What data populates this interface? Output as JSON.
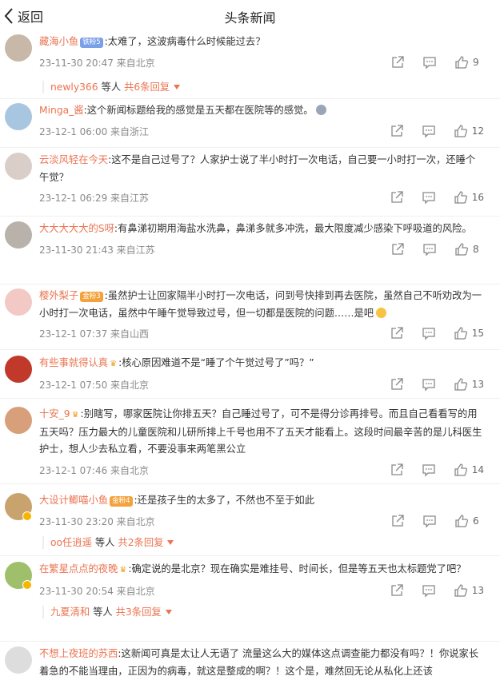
{
  "header": {
    "back_label": "返回",
    "title": "头条新闻"
  },
  "comments": [
    {
      "user": "藏海小鱼",
      "badge": "铁粉5",
      "badge_color": "#7aa0e8",
      "text": ":太难了，这波病毒什么时候能过去？",
      "time": "23-11-30 20:47 来自北京",
      "likes": "9",
      "reply_user": "newly366",
      "reply_mid": "等人",
      "reply_count": "共6条回复",
      "avatar_color": "#c8b8a8"
    },
    {
      "user": "Minga_酱",
      "text": ":这个新闻标题给我的感觉是五天都在医院等的感觉。",
      "time": "23-12-1 06:00 来自浙江",
      "likes": "12",
      "avatar_color": "#a9c6e0"
    },
    {
      "user": "云淡风轻在今天",
      "text": ":这不是自己过号了？人家护士说了半小时打一次电话，自己要一小时打一次，还睡个午觉？",
      "time": "23-12-1 06:29 来自江苏",
      "likes": "16",
      "avatar_color": "#d9cfc8"
    },
    {
      "user": "大大大大大的S呀",
      "text": ":有鼻涕初期用海盐水洗鼻，鼻涕多就多冲洗，最大限度减少感染下呼吸道的风险。",
      "time": "23-11-30 21:43 来自江苏",
      "likes": "8",
      "avatar_color": "#b9b2aa"
    },
    {
      "user": "樱外梨子",
      "badge": "金粉3",
      "badge_color": "#f3a23c",
      "text": ":虽然护士让回家隔半小时打一次电话，问到号快排到再去医院，虽然自己不听劝改为一小时打一次电话，虽然中午睡午觉导致过号，但一切都是医院的问题……是吧",
      "time": "23-12-1 07:37 来自山西",
      "likes": "15",
      "avatar_color": "#f2c9c4"
    },
    {
      "user": "有些事就得认真",
      "crown": "♛",
      "text": ":核心原因难道不是“睡了个午觉过号了”吗？”",
      "time": "23-12-1 07:50 来自北京",
      "likes": "13",
      "avatar_color": "#c0392b"
    },
    {
      "user": "十安_9",
      "crown": "♛",
      "text": ":别瞎写，哪家医院让你排五天？自己睡过号了，可不是得分诊再排号。而且自己看看写的用五天吗？压力最大的儿童医院和儿研所排上千号也用不了五天才能看上。这段时间最辛苦的是儿科医生护士，想人少去私立看，不要没事来两笔黑公立",
      "time": "23-12-1 07:46 来自北京",
      "likes": "14",
      "avatar_color": "#d8a07a"
    },
    {
      "user": "大设计鲫喵小鱼",
      "badge": "金粉4",
      "badge_color": "#f3a23c",
      "text": ":还是孩子生的太多了，不然也不至于如此",
      "time": "23-11-30 23:20 来自北京",
      "likes": "6",
      "reply_user": "oo任逍遥",
      "reply_mid": "等人",
      "reply_count": "共2条回复",
      "avatar_color": "#c9a36e"
    },
    {
      "user": "在繁星点点的夜晚",
      "crown": "♛",
      "text": ":确定说的是北京？现在确实是难挂号、时间长，但是等五天也太标题党了吧？",
      "time": "23-11-30 20:54 来自北京",
      "likes": "13",
      "reply_user": "九夏清和",
      "reply_mid": "等人",
      "reply_count": "共3条回复",
      "avatar_color": "#9fbf6a"
    },
    {
      "user": "不想上夜班的苏西",
      "text": ":这新闻可真是太让人无语了 流量这么大的媒体这点调查能力都没有吗？！你说家长着急的不能当理由，正因为的病毒，就这是整成的啊？！这个是，难然回无论从私化上还该",
      "time": "",
      "likes": "",
      "avatar_color": "#dddddd"
    }
  ]
}
